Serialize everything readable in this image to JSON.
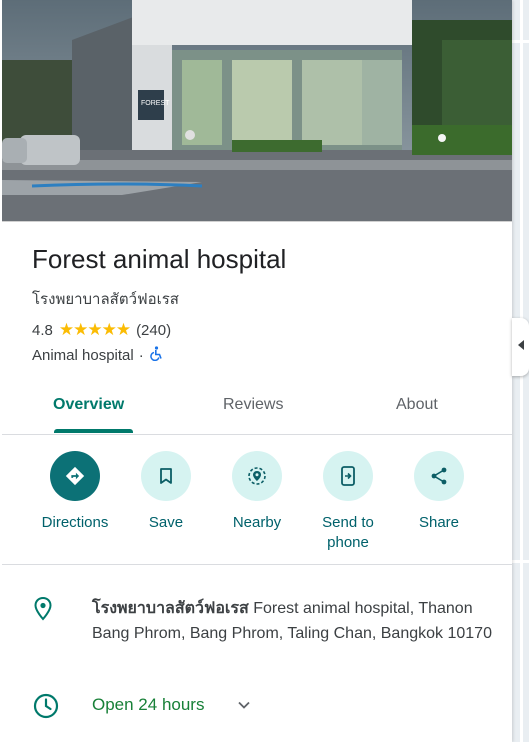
{
  "place": {
    "name": "Forest animal hospital",
    "local_name": "โรงพยาบาลสัตว์ฟอเรส",
    "rating": "4.8",
    "stars": "★★★★★",
    "review_count": "(240)",
    "category": "Animal hospital",
    "separator": "·",
    "photo_sign_text": "FOREST"
  },
  "tabs": [
    {
      "label": "Overview",
      "active": true
    },
    {
      "label": "Reviews",
      "active": false
    },
    {
      "label": "About",
      "active": false
    }
  ],
  "actions": [
    {
      "label": "Directions",
      "icon": "directions-icon"
    },
    {
      "label": "Save",
      "icon": "bookmark-icon"
    },
    {
      "label": "Nearby",
      "icon": "nearby-icon"
    },
    {
      "label": "Send to phone",
      "icon": "send-to-phone-icon"
    },
    {
      "label": "Share",
      "icon": "share-icon"
    }
  ],
  "address": {
    "bold_name": "โรงพยาบาลสัตว์ฟอเรส",
    "text": "Forest animal hospital, Thanon Bang Phrom, Bang Phrom, Taling Chan, Bangkok 10170"
  },
  "hours": {
    "status": "Open 24 hours"
  },
  "colors": {
    "accent": "#00796b",
    "primary_button": "#0c7176",
    "secondary_button": "#d6f3f1",
    "star": "#fbbc04",
    "open_status": "#188038",
    "accessibility": "#1a73e8"
  }
}
